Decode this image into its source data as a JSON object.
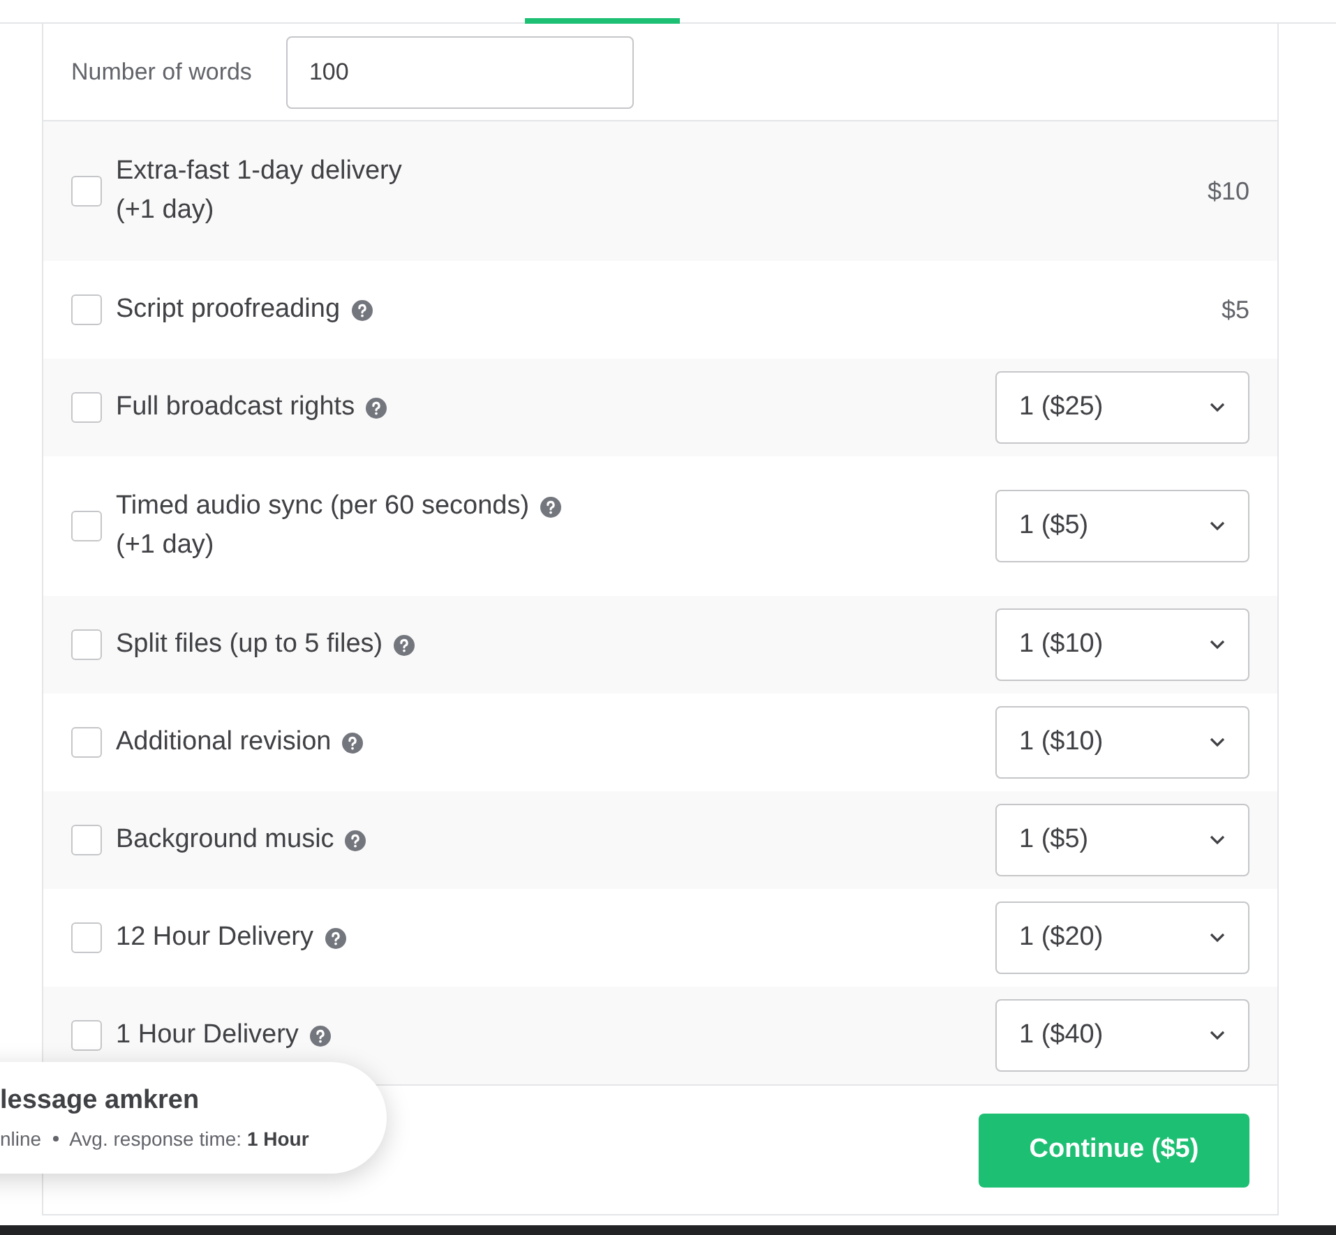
{
  "words": {
    "label": "Number of words",
    "value": "100"
  },
  "extras": [
    {
      "kind": "price",
      "label": "Extra-fast 1-day delivery",
      "note": "(+1 day)",
      "help": false,
      "checked": false,
      "price": "$10"
    },
    {
      "kind": "price",
      "label": "Script proofreading",
      "help": true,
      "checked": false,
      "price": "$5"
    },
    {
      "kind": "select",
      "label": "Full broadcast rights",
      "help": true,
      "checked": false,
      "value": "1 ($25)"
    },
    {
      "kind": "select",
      "label": "Timed audio sync (per 60 seconds)",
      "note": "(+1 day)",
      "help": true,
      "checked": false,
      "value": "1 ($5)"
    },
    {
      "kind": "select",
      "label": "Split files (up to 5 files)",
      "help": true,
      "checked": false,
      "value": "1 ($10)"
    },
    {
      "kind": "select",
      "label": "Additional revision",
      "help": true,
      "checked": false,
      "value": "1 ($10)"
    },
    {
      "kind": "select",
      "label": "Background music",
      "help": true,
      "checked": false,
      "value": "1 ($5)"
    },
    {
      "kind": "select",
      "label": "12 Hour Delivery",
      "help": true,
      "checked": false,
      "value": "1 ($20)"
    },
    {
      "kind": "select",
      "label": "1 Hour Delivery",
      "help": true,
      "checked": false,
      "value": "1 ($40)"
    }
  ],
  "chat": {
    "title": "lessage amkren",
    "status": "nline",
    "response_label": "Avg. response time:",
    "response_value": "1 Hour"
  },
  "continue_button": "Continue ($5)"
}
